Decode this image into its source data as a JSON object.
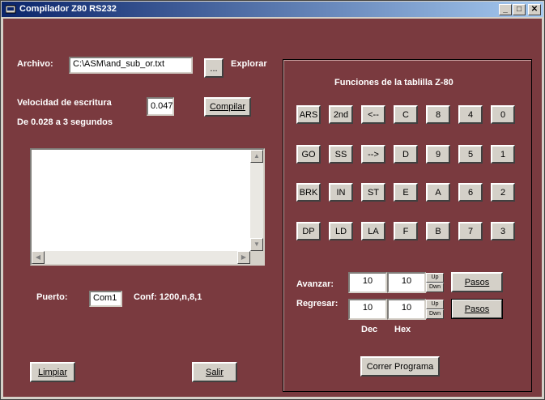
{
  "window": {
    "title": "Compilador Z80 RS232",
    "minimize": "_",
    "maximize": "□",
    "close": "✕"
  },
  "archivo": {
    "label": "Archivo:",
    "value": "C:\\ASM\\and_sub_or.txt",
    "browse_label": "...",
    "explorar_label": "Explorar"
  },
  "velocidad": {
    "label": "Velocidad de escritura",
    "value": "0.047",
    "range_text": "De 0.028 a 3 segundos"
  },
  "compilar_label": "Compilar",
  "output_text": "",
  "puerto": {
    "label": "Puerto:",
    "value": "Com1",
    "conf": "Conf: 1200,n,8,1"
  },
  "limpiar_label": "Limpiar",
  "salir_label": "Salir",
  "panel": {
    "title": "Funciones de la tablilla Z-80",
    "keys": [
      [
        "ARS",
        "2nd",
        "<--",
        "C",
        "8",
        "4",
        "0"
      ],
      [
        "GO",
        "SS",
        "-->",
        "D",
        "9",
        "5",
        "1"
      ],
      [
        "BRK",
        "IN",
        "ST",
        "E",
        "A",
        "6",
        "2"
      ],
      [
        "DP",
        "LD",
        "LA",
        "F",
        "B",
        "7",
        "3"
      ]
    ],
    "avanzar": {
      "label": "Avanzar:",
      "dec": "10",
      "hex": "10",
      "up": "Up",
      "down": "Dwn",
      "pasos_label": "Pasos"
    },
    "regresar": {
      "label": "Regresar:",
      "dec": "10",
      "hex": "10",
      "up": "Up",
      "down": "Dwn",
      "pasos_label": "Pasos"
    },
    "dec_label": "Dec",
    "hex_label": "Hex",
    "correr_label": "Correr Programa"
  }
}
